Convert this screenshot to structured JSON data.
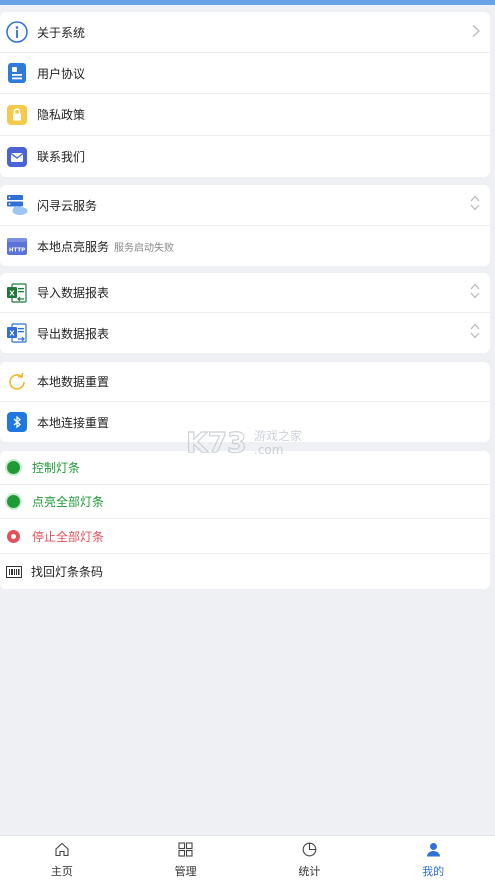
{
  "menu": {
    "group1": [
      {
        "label": "关于系统",
        "icon": "info-icon"
      },
      {
        "label": "用户协议",
        "icon": "document-icon"
      },
      {
        "label": "隐私政策",
        "icon": "lock-icon"
      },
      {
        "label": "联系我们",
        "icon": "mail-icon"
      }
    ],
    "group2": [
      {
        "label": "闪寻云服务",
        "icon": "cloud-server-icon"
      },
      {
        "label": "本地点亮服务",
        "sub": "服务启动失败",
        "icon": "http-icon"
      }
    ],
    "group3": [
      {
        "label": "导入数据报表",
        "icon": "excel-import-icon"
      },
      {
        "label": "导出数据报表",
        "icon": "excel-export-icon"
      }
    ],
    "group4": [
      {
        "label": "本地数据重置",
        "icon": "refresh-icon"
      },
      {
        "label": "本地连接重置",
        "icon": "bluetooth-icon"
      }
    ],
    "group5": [
      {
        "label": "控制灯条",
        "icon": "green-dot-icon"
      },
      {
        "label": "点亮全部灯条",
        "icon": "green-dot-icon"
      },
      {
        "label": "停止全部灯条",
        "icon": "stop-icon"
      },
      {
        "label": "找回灯条条码",
        "icon": "barcode-icon"
      }
    ]
  },
  "tabs": [
    {
      "label": "主页",
      "icon": "home-icon"
    },
    {
      "label": "管理",
      "icon": "grid-icon"
    },
    {
      "label": "统计",
      "icon": "pie-chart-icon"
    },
    {
      "label": "我的",
      "icon": "user-icon",
      "active": true
    }
  ],
  "watermark": {
    "brand": "K73",
    "cn": "游戏之家",
    "domain": ".com"
  },
  "colors": {
    "accent": "#2f6fd6",
    "green": "#1f9a36",
    "red": "#e2515b",
    "topbar": "#6aa2e6"
  }
}
